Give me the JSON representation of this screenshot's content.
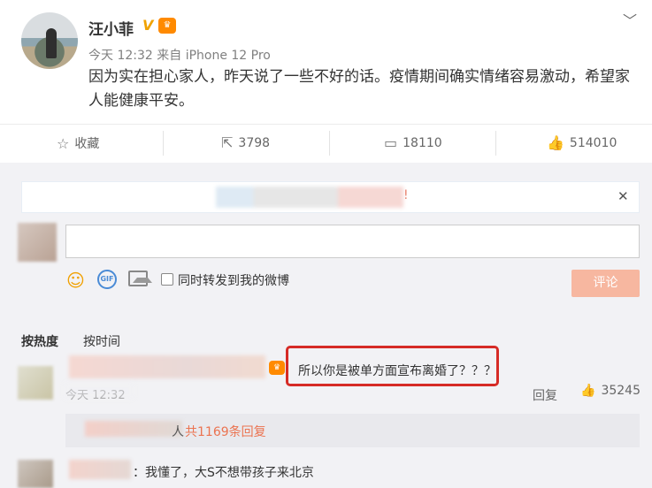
{
  "post": {
    "username": "汪小菲",
    "v_badge": "V",
    "meta": "今天 12:32 来自 iPhone 12 Pro",
    "text": "因为实在担心家人，昨天说了一些不好的话。疫情期间确实情绪容易激动，希望家人能健康平安。"
  },
  "actions": {
    "favorite": "收藏",
    "repost": "3798",
    "comment": "18110",
    "like": "514010"
  },
  "notice": {
    "tail": "!"
  },
  "composer": {
    "repost_checkbox_label": "同时转发到我的微博",
    "submit_label": "评论",
    "gif_label": "GIF"
  },
  "sort": {
    "hot": "按热度",
    "time": "按时间"
  },
  "comments": [
    {
      "text": "所以你是被单方面宣布离婚了？？？",
      "time": "今天 12:32",
      "reply": "回复",
      "likes": "35245",
      "sub_suffix": "人",
      "sub_count": "共1169条回复"
    },
    {
      "text": "：我懂了，大S不想带孩子来北京"
    }
  ],
  "colors": {
    "highlight_box": "#d62b26",
    "submit_bg": "#f7b7a0",
    "link_orange": "#eb7350"
  }
}
